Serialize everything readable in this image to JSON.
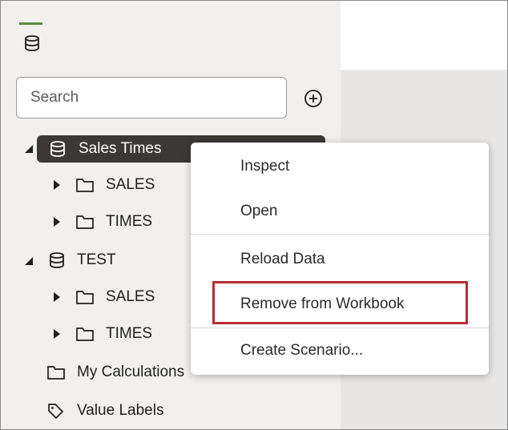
{
  "search": {
    "placeholder": "Search",
    "value": ""
  },
  "tree": [
    {
      "label": "Sales Times",
      "icon": "database-icon",
      "expanded": true,
      "selected": true
    },
    {
      "label": "SALES",
      "icon": "folder-icon",
      "expanded": false
    },
    {
      "label": "TIMES",
      "icon": "folder-icon",
      "expanded": false
    },
    {
      "label": "TEST",
      "icon": "database-icon",
      "expanded": true
    },
    {
      "label": "SALES",
      "icon": "folder-icon",
      "expanded": false
    },
    {
      "label": "TIMES",
      "icon": "folder-icon",
      "expanded": false
    },
    {
      "label": "My Calculations",
      "icon": "folder-icon"
    },
    {
      "label": "Value Labels",
      "icon": "tag-icon"
    }
  ],
  "context_menu": {
    "items": [
      {
        "label": "Inspect"
      },
      {
        "label": "Open"
      },
      {
        "label": "Reload Data"
      },
      {
        "label": "Remove from Workbook",
        "highlighted": true
      },
      {
        "label": "Create Scenario..."
      }
    ]
  },
  "colors": {
    "panel_bg": "#f1f0ee",
    "canvas_bg": "#e8e7e5",
    "selected_bg": "#3b3835",
    "highlight_border": "#b82c33",
    "tab_accent": "#5e8a45"
  }
}
